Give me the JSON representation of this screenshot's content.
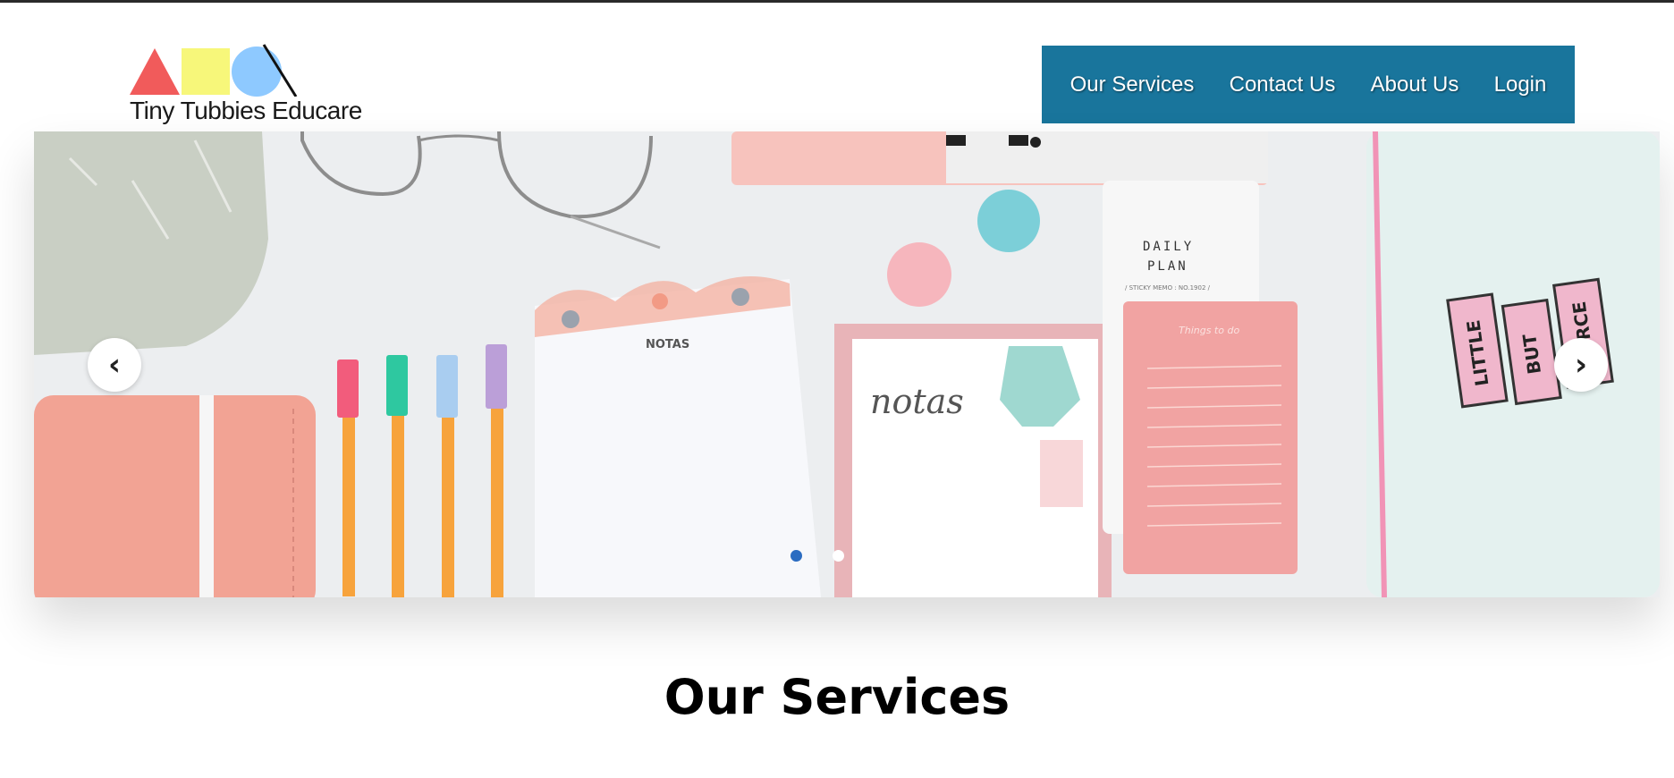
{
  "brand": {
    "name": "Tiny Tubbies Educare",
    "shape_colors": {
      "triangle": "#f15b5b",
      "square": "#f7f77a",
      "circle": "#8ec9ff"
    }
  },
  "nav": {
    "bg_color": "#19759c",
    "items": [
      {
        "label": "Our Services"
      },
      {
        "label": "Contact Us"
      },
      {
        "label": "About Us"
      },
      {
        "label": "Login"
      }
    ]
  },
  "carousel": {
    "prev_icon": "‹",
    "next_icon": "›",
    "slide_count": 3,
    "active_slide": 1,
    "slide_text": {
      "notepad_left": "NOTAS",
      "notepad_mid": "notas",
      "daily_plan_line1": "DAILY",
      "daily_plan_line2": "PLAN",
      "sticky_memo": "/ STICKY MEMO : NO.1902 /",
      "things_to_do": "Things to do",
      "pouch_1": "LITTLE",
      "pouch_2": "BUT",
      "pouch_3": "FIERCE"
    }
  },
  "services": {
    "title": "Our Services"
  }
}
